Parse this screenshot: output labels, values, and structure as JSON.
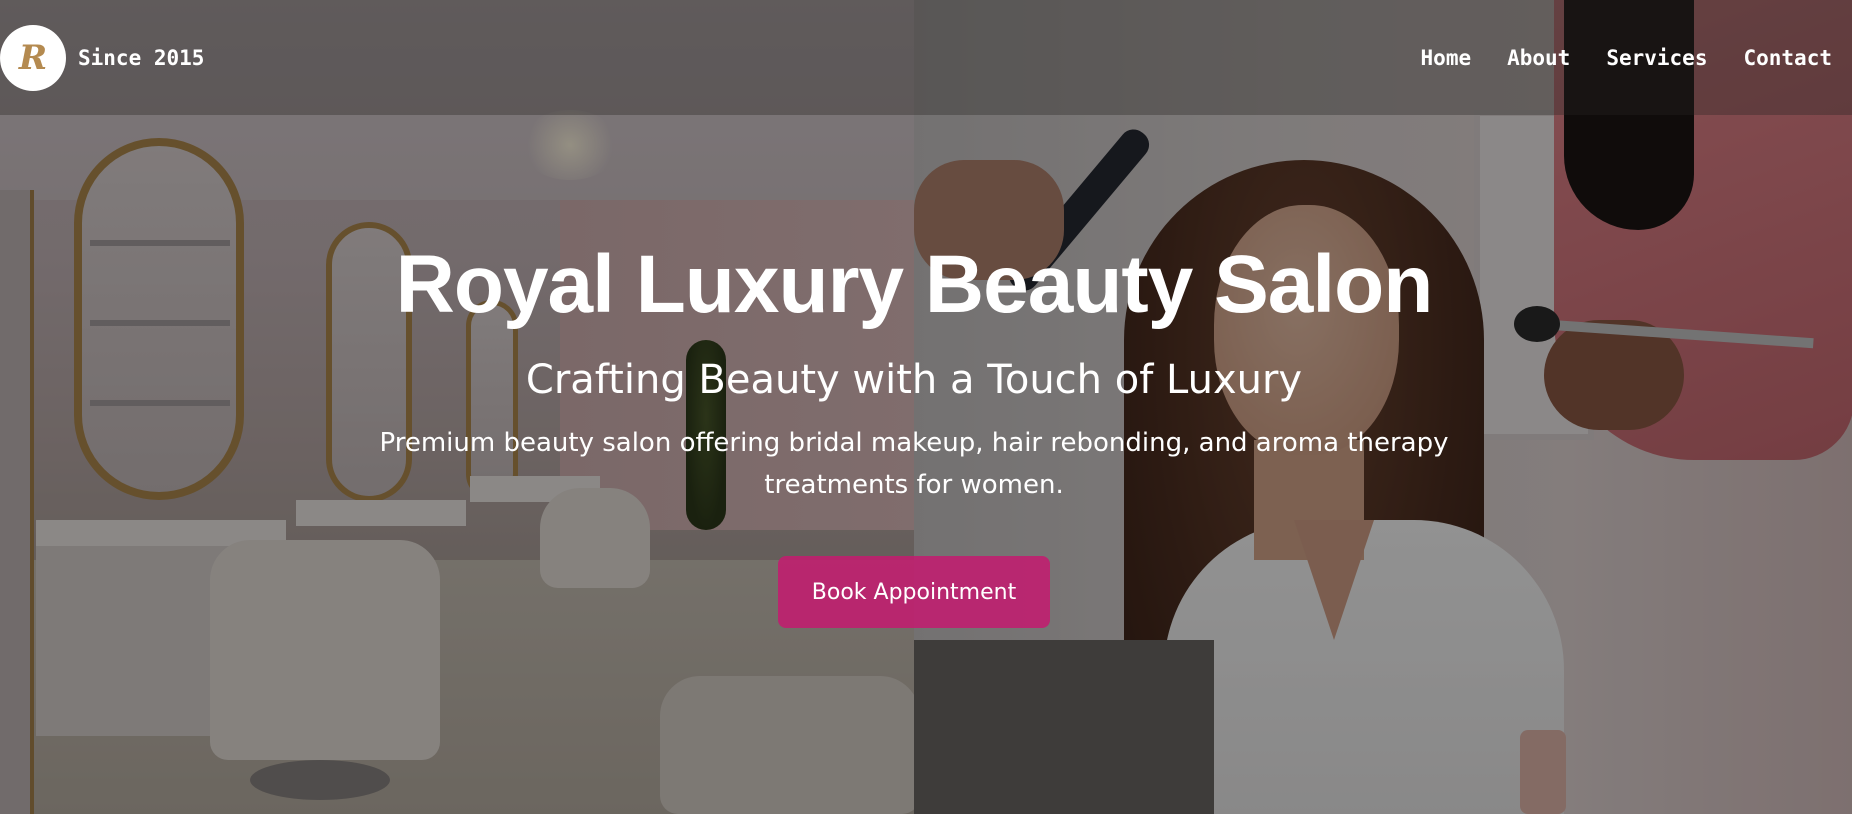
{
  "brand": {
    "logo_letter": "R",
    "tagline": "Since 2015"
  },
  "nav": {
    "items": [
      "Home",
      "About",
      "Services",
      "Contact"
    ]
  },
  "hero": {
    "title": "Royal Luxury Beauty Salon",
    "subtitle": "Crafting Beauty with a Touch of Luxury",
    "description": "Premium beauty salon offering bridal makeup, hair rebonding, and aroma therapy treatments for women.",
    "cta_label": "Book Appointment"
  },
  "colors": {
    "accent": "#c41a70",
    "logo_gold": "#b48a50",
    "text": "#ffffff"
  }
}
